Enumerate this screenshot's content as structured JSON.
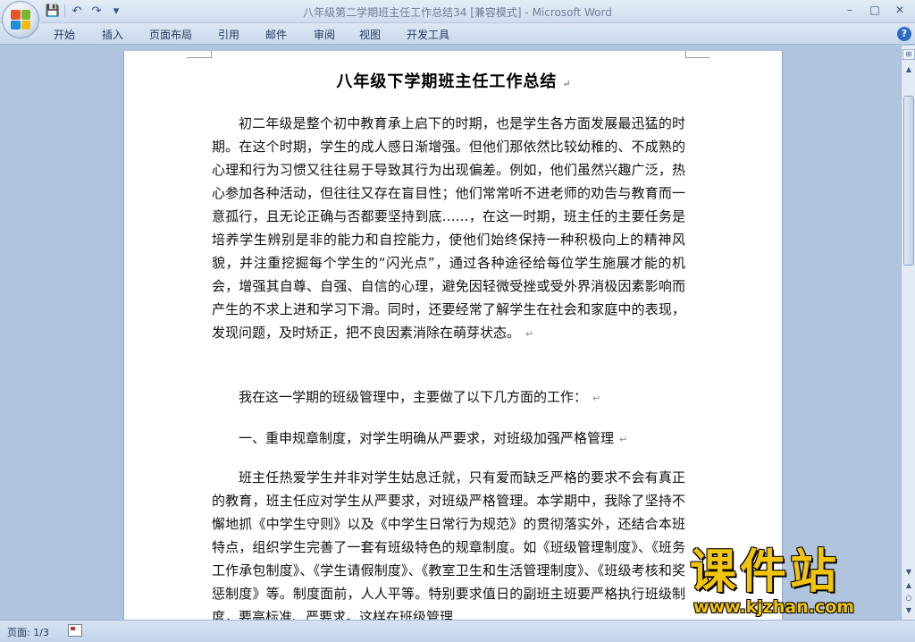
{
  "window": {
    "title": "八年级第二学期班主任工作总结34 [兼容模式] - Microsoft Word",
    "controls": [
      "–",
      "□",
      "✕"
    ]
  },
  "qat": {
    "save": "💾",
    "undo": "↶",
    "redo": "↷",
    "more": "▾"
  },
  "ribbon": {
    "tabs": [
      "开始",
      "插入",
      "页面布局",
      "引用",
      "邮件",
      "审阅",
      "视图",
      "开发工具"
    ],
    "help": "?"
  },
  "document": {
    "title": "八年级下学期班主任工作总结",
    "paragraphs": [
      "初二年级是整个初中教育承上启下的时期，也是学生各方面发展最迅猛的时期。在这个时期，学生的成人感日渐增强。但他们那依然比较幼稚的、不成熟的心理和行为习惯又往往易于导致其行为出现偏差。例如，他们虽然兴趣广泛，热心参加各种活动，但往往又存在盲目性；他们常常听不进老师的劝告与教育而一意孤行，且无论正确与否都要坚持到底……，在这一时期，班主任的主要任务是培养学生辨别是非的能力和自控能力，使他们始终保持一种积极向上的精神风貌，并注重挖掘每个学生的“闪光点”，通过各种途径给每位学生施展才能的机会，增强其自尊、自强、自信的心理，避免因轻微受挫或受外界消极因素影响而产生的不求上进和学习下滑。同时，还要经常了解学生在社会和家庭中的表现，发现问题，及时矫正，把不良因素消除在萌芽状态。",
      "我在这一学期的班级管理中，主要做了以下几方面的工作：",
      "一、重申规章制度，对学生明确从严要求，对班级加强严格管理",
      "班主任热爱学生并非对学生姑息迁就，只有爱而缺乏严格的要求不会有真正的教育，班主任应对学生从严要求，对班级严格管理。本学期中，我除了坚持不懈地抓《中学生守则》以及《中学生日常行为规范》的贯彻落实外，还结合本班特点，组织学生完善了一套有班级特色的规章制度。如《班级管理制度》、《班务工作承包制度》、《学生请假制度》、《教室卫生和生活管理制度》、《班级考核和奖惩制度》等。制度面前，人人平等。特别要求值日的副班主班要严格执行班级制度，要高标准、严要求。这样在班级管理"
    ],
    "paragraph_mark": "↵"
  },
  "statusbar": {
    "page": "页面: 1/3"
  },
  "watermark": {
    "main": "课件站",
    "url": "www.kjzhan.com"
  }
}
